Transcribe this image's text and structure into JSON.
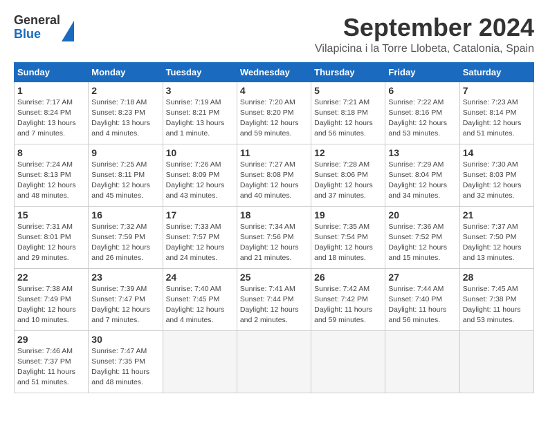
{
  "logo": {
    "general": "General",
    "blue": "Blue"
  },
  "title": "September 2024",
  "location": "Vilapicina i la Torre Llobeta, Catalonia, Spain",
  "headers": [
    "Sunday",
    "Monday",
    "Tuesday",
    "Wednesday",
    "Thursday",
    "Friday",
    "Saturday"
  ],
  "weeks": [
    [
      {
        "day": "1",
        "sunrise": "Sunrise: 7:17 AM",
        "sunset": "Sunset: 8:24 PM",
        "daylight": "Daylight: 13 hours and 7 minutes."
      },
      {
        "day": "2",
        "sunrise": "Sunrise: 7:18 AM",
        "sunset": "Sunset: 8:23 PM",
        "daylight": "Daylight: 13 hours and 4 minutes."
      },
      {
        "day": "3",
        "sunrise": "Sunrise: 7:19 AM",
        "sunset": "Sunset: 8:21 PM",
        "daylight": "Daylight: 13 hours and 1 minute."
      },
      {
        "day": "4",
        "sunrise": "Sunrise: 7:20 AM",
        "sunset": "Sunset: 8:20 PM",
        "daylight": "Daylight: 12 hours and 59 minutes."
      },
      {
        "day": "5",
        "sunrise": "Sunrise: 7:21 AM",
        "sunset": "Sunset: 8:18 PM",
        "daylight": "Daylight: 12 hours and 56 minutes."
      },
      {
        "day": "6",
        "sunrise": "Sunrise: 7:22 AM",
        "sunset": "Sunset: 8:16 PM",
        "daylight": "Daylight: 12 hours and 53 minutes."
      },
      {
        "day": "7",
        "sunrise": "Sunrise: 7:23 AM",
        "sunset": "Sunset: 8:14 PM",
        "daylight": "Daylight: 12 hours and 51 minutes."
      }
    ],
    [
      {
        "day": "8",
        "sunrise": "Sunrise: 7:24 AM",
        "sunset": "Sunset: 8:13 PM",
        "daylight": "Daylight: 12 hours and 48 minutes."
      },
      {
        "day": "9",
        "sunrise": "Sunrise: 7:25 AM",
        "sunset": "Sunset: 8:11 PM",
        "daylight": "Daylight: 12 hours and 45 minutes."
      },
      {
        "day": "10",
        "sunrise": "Sunrise: 7:26 AM",
        "sunset": "Sunset: 8:09 PM",
        "daylight": "Daylight: 12 hours and 43 minutes."
      },
      {
        "day": "11",
        "sunrise": "Sunrise: 7:27 AM",
        "sunset": "Sunset: 8:08 PM",
        "daylight": "Daylight: 12 hours and 40 minutes."
      },
      {
        "day": "12",
        "sunrise": "Sunrise: 7:28 AM",
        "sunset": "Sunset: 8:06 PM",
        "daylight": "Daylight: 12 hours and 37 minutes."
      },
      {
        "day": "13",
        "sunrise": "Sunrise: 7:29 AM",
        "sunset": "Sunset: 8:04 PM",
        "daylight": "Daylight: 12 hours and 34 minutes."
      },
      {
        "day": "14",
        "sunrise": "Sunrise: 7:30 AM",
        "sunset": "Sunset: 8:03 PM",
        "daylight": "Daylight: 12 hours and 32 minutes."
      }
    ],
    [
      {
        "day": "15",
        "sunrise": "Sunrise: 7:31 AM",
        "sunset": "Sunset: 8:01 PM",
        "daylight": "Daylight: 12 hours and 29 minutes."
      },
      {
        "day": "16",
        "sunrise": "Sunrise: 7:32 AM",
        "sunset": "Sunset: 7:59 PM",
        "daylight": "Daylight: 12 hours and 26 minutes."
      },
      {
        "day": "17",
        "sunrise": "Sunrise: 7:33 AM",
        "sunset": "Sunset: 7:57 PM",
        "daylight": "Daylight: 12 hours and 24 minutes."
      },
      {
        "day": "18",
        "sunrise": "Sunrise: 7:34 AM",
        "sunset": "Sunset: 7:56 PM",
        "daylight": "Daylight: 12 hours and 21 minutes."
      },
      {
        "day": "19",
        "sunrise": "Sunrise: 7:35 AM",
        "sunset": "Sunset: 7:54 PM",
        "daylight": "Daylight: 12 hours and 18 minutes."
      },
      {
        "day": "20",
        "sunrise": "Sunrise: 7:36 AM",
        "sunset": "Sunset: 7:52 PM",
        "daylight": "Daylight: 12 hours and 15 minutes."
      },
      {
        "day": "21",
        "sunrise": "Sunrise: 7:37 AM",
        "sunset": "Sunset: 7:50 PM",
        "daylight": "Daylight: 12 hours and 13 minutes."
      }
    ],
    [
      {
        "day": "22",
        "sunrise": "Sunrise: 7:38 AM",
        "sunset": "Sunset: 7:49 PM",
        "daylight": "Daylight: 12 hours and 10 minutes."
      },
      {
        "day": "23",
        "sunrise": "Sunrise: 7:39 AM",
        "sunset": "Sunset: 7:47 PM",
        "daylight": "Daylight: 12 hours and 7 minutes."
      },
      {
        "day": "24",
        "sunrise": "Sunrise: 7:40 AM",
        "sunset": "Sunset: 7:45 PM",
        "daylight": "Daylight: 12 hours and 4 minutes."
      },
      {
        "day": "25",
        "sunrise": "Sunrise: 7:41 AM",
        "sunset": "Sunset: 7:44 PM",
        "daylight": "Daylight: 12 hours and 2 minutes."
      },
      {
        "day": "26",
        "sunrise": "Sunrise: 7:42 AM",
        "sunset": "Sunset: 7:42 PM",
        "daylight": "Daylight: 11 hours and 59 minutes."
      },
      {
        "day": "27",
        "sunrise": "Sunrise: 7:44 AM",
        "sunset": "Sunset: 7:40 PM",
        "daylight": "Daylight: 11 hours and 56 minutes."
      },
      {
        "day": "28",
        "sunrise": "Sunrise: 7:45 AM",
        "sunset": "Sunset: 7:38 PM",
        "daylight": "Daylight: 11 hours and 53 minutes."
      }
    ],
    [
      {
        "day": "29",
        "sunrise": "Sunrise: 7:46 AM",
        "sunset": "Sunset: 7:37 PM",
        "daylight": "Daylight: 11 hours and 51 minutes."
      },
      {
        "day": "30",
        "sunrise": "Sunrise: 7:47 AM",
        "sunset": "Sunset: 7:35 PM",
        "daylight": "Daylight: 11 hours and 48 minutes."
      },
      null,
      null,
      null,
      null,
      null
    ]
  ]
}
